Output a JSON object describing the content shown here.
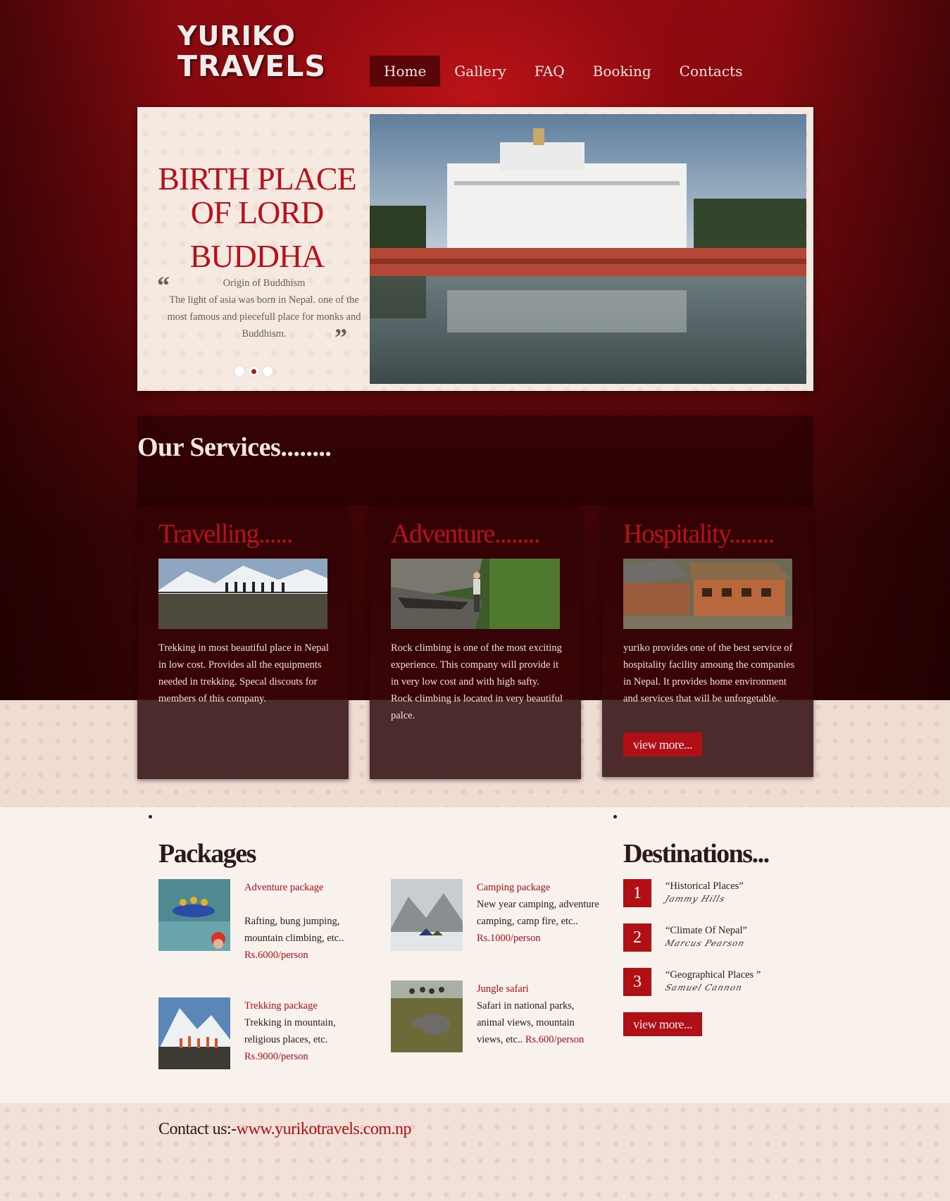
{
  "brand": {
    "line1": "YURIKO",
    "line2": "TRAVELS"
  },
  "nav": [
    "Home",
    "Gallery",
    "FAQ",
    "Booking",
    "Contacts"
  ],
  "slider": {
    "title_line1": "BIRTH PLACE",
    "title_line2": "OF LORD",
    "title_line3": "BUDDHA",
    "subtitle": "Origin of Buddhism",
    "text": "The light of asia was born in Nepal. one of the most famous and piecefull place for monks and Buddhism.",
    "quote_open": "“",
    "quote_close": "”",
    "active_dot": 1
  },
  "services": {
    "title": "Our Services........",
    "cards": [
      {
        "title": "Travelling......",
        "text": "Trekking in most beautiful place in Nepal in low cost. Provides all the equipments needed in trekking. Specal discouts for members of this company."
      },
      {
        "title": "Adventure........",
        "text": "Rock climbing is one of the most exciting experience. This company will provide it in very low cost and with high safty. Rock climbing is located in very beautiful palce."
      },
      {
        "title": "Hospitality........",
        "text": "yuriko provides one of the best service of hospitality facility amoung the companies in Nepal. It provides home environment and services that will be unforgetable.",
        "button": "view more..."
      }
    ]
  },
  "packages": {
    "title": "Packages",
    "items": [
      {
        "name": "Adventure package",
        "desc": "Rafting, bung jumping, mountain climbing, etc..",
        "price": "Rs.6000/person"
      },
      {
        "name": "Camping package",
        "desc": "New year camping, adventure camping, camp fire, etc..",
        "price": "Rs.1000/person"
      },
      {
        "name": "Trekking package",
        "desc": "Trekking in mountain, religious places, etc.",
        "price": "Rs.9000/person"
      },
      {
        "name": "Jungle safari",
        "desc": "Safari in national parks, animal views, mountain views, etc..",
        "price": "Rs.600/person"
      }
    ]
  },
  "destinations": {
    "title": "Destinations...",
    "items": [
      {
        "num": "1",
        "label": "“Historical Places”",
        "sig": "Jammy Hills"
      },
      {
        "num": "2",
        "label": "“Climate Of Nepal”",
        "sig": "Marcus Pearson"
      },
      {
        "num": "3",
        "label": "“Geographical Places ”",
        "sig": "Samuel Cannon"
      }
    ],
    "button": "view more..."
  },
  "footer": {
    "label": "Contact us:-",
    "link": "www.yurikotravels.com.np"
  },
  "colors": {
    "accent": "#b10f16",
    "header_bg": "#7a0a0e",
    "card_bg": "#4b2b2c"
  }
}
